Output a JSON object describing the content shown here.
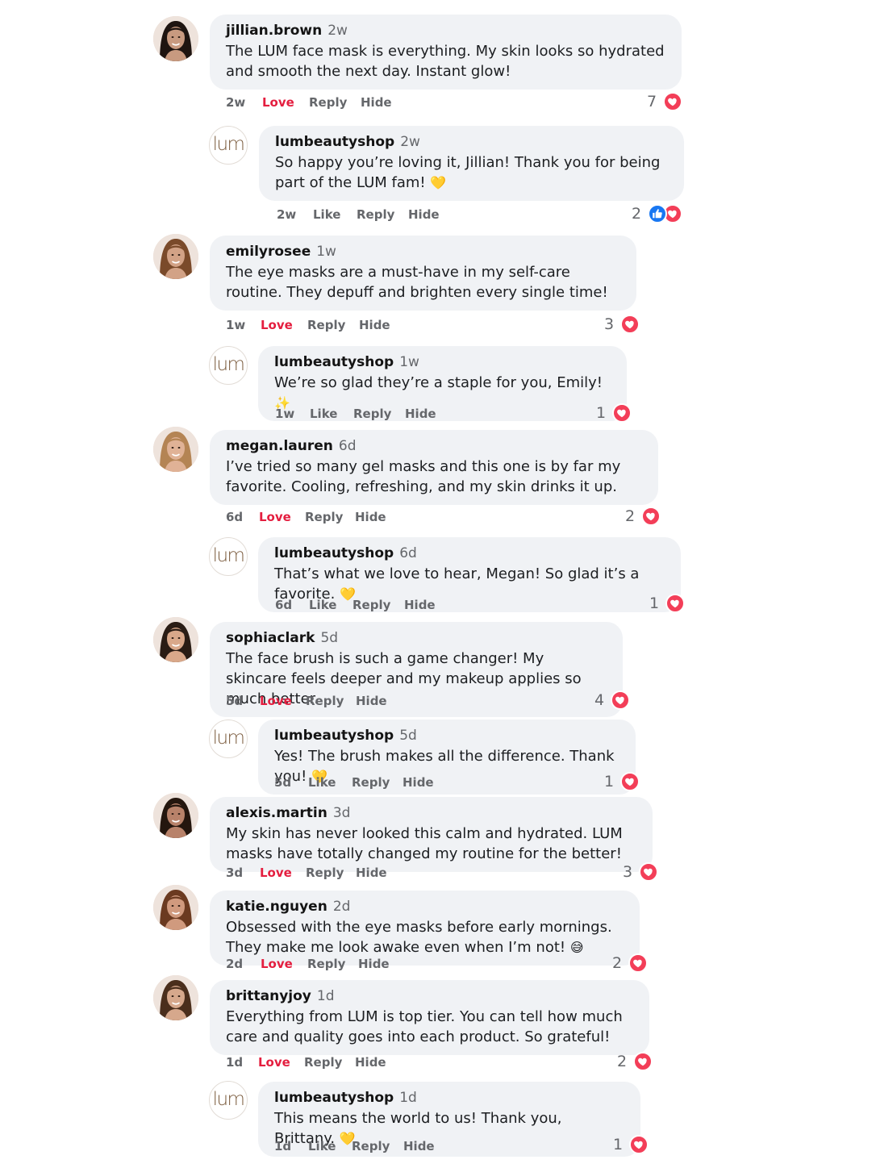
{
  "actions": {
    "love": "Love",
    "like": "Like",
    "reply": "Reply",
    "hide": "Hide"
  },
  "colors": {
    "love": "#e41e3f",
    "heart": "#f33e58",
    "like": "#1877f2",
    "bubble": "#f0f2f5",
    "meta": "#65676b"
  },
  "brand_logo_text": "lum",
  "comments": [
    {
      "username": "jillian.brown",
      "time": "2w",
      "text": "The LUM face mask is everything. My skin looks so hydrated and smooth the next day. Instant glow!",
      "emoji": "",
      "reaction_label": "Love",
      "count": "7",
      "reactions": [
        "heart-icon"
      ]
    },
    {
      "username": "lumbeautyshop",
      "time": "2w",
      "text": "So happy you’re loving it, Jillian! Thank you for being part of the LUM fam!",
      "emoji": "💛",
      "reaction_label": "Like",
      "count": "2",
      "reactions": [
        "like-icon",
        "heart-icon"
      ]
    },
    {
      "username": "emilyrosee",
      "time": "1w",
      "text": "The eye masks are a must-have in my self-care routine. They depuff and brighten every single time!",
      "emoji": "",
      "reaction_label": "Love",
      "count": "3",
      "reactions": [
        "heart-icon"
      ]
    },
    {
      "username": "lumbeautyshop",
      "time": "1w",
      "text": "We’re so glad they’re a staple for you, Emily!",
      "emoji": "✨",
      "reaction_label": "Like",
      "count": "1",
      "reactions": [
        "heart-icon"
      ]
    },
    {
      "username": "megan.lauren",
      "time": "6d",
      "text": "I’ve tried so many gel masks and this one is by far my favorite. Cooling, refreshing, and my skin drinks it up.",
      "emoji": "",
      "reaction_label": "Love",
      "count": "2",
      "reactions": [
        "heart-icon"
      ]
    },
    {
      "username": "lumbeautyshop",
      "time": "6d",
      "text": "That’s what we love to hear, Megan! So glad it’s a favorite.",
      "emoji": "💛",
      "reaction_label": "Like",
      "count": "1",
      "reactions": [
        "heart-icon"
      ]
    },
    {
      "username": "sophiaclark",
      "time": "5d",
      "text": "The face brush is such a game changer! My skincare feels deeper and my makeup applies so much better.",
      "emoji": "",
      "reaction_label": "Love",
      "count": "4",
      "reactions": [
        "heart-icon"
      ]
    },
    {
      "username": "lumbeautyshop",
      "time": "5d",
      "text": "Yes! The brush makes all the difference. Thank you!",
      "emoji": "💛",
      "reaction_label": "Like",
      "count": "1",
      "reactions": [
        "heart-icon"
      ]
    },
    {
      "username": "alexis.martin",
      "time": "3d",
      "text": "My skin has never looked this calm and hydrated. LUM masks have totally changed my routine for the better!",
      "emoji": "",
      "reaction_label": "Love",
      "count": "3",
      "reactions": [
        "heart-icon"
      ]
    },
    {
      "username": "katie.nguyen",
      "time": "2d",
      "text": "Obsessed with the eye masks before early mornings. They make me look awake even when I’m not!",
      "emoji": "😅",
      "reaction_label": "Love",
      "count": "2",
      "reactions": [
        "heart-icon"
      ]
    },
    {
      "username": "brittanyjoy",
      "time": "1d",
      "text": "Everything from LUM is top tier. You can tell how much care and quality goes into each product. So grateful!",
      "emoji": "",
      "reaction_label": "Love",
      "count": "2",
      "reactions": [
        "heart-icon"
      ]
    },
    {
      "username": "lumbeautyshop",
      "time": "1d",
      "text": "This means the world to us! Thank you, Brittany.",
      "emoji": "💛",
      "reaction_label": "Like",
      "count": "1",
      "reactions": [
        "heart-icon"
      ]
    }
  ]
}
